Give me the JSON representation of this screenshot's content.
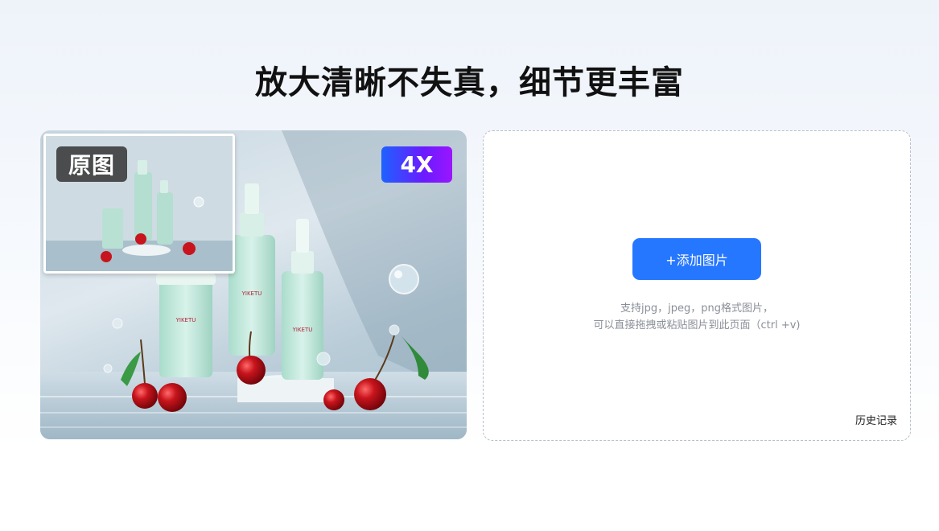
{
  "headline": "放大清晰不失真，细节更丰富",
  "showcase": {
    "original_badge": "原图",
    "zoom_badge": "4X",
    "product_labels": [
      "YIKETU",
      "YIKETU",
      "YIKETU"
    ]
  },
  "upload": {
    "add_button": "+添加图片",
    "hint_line1": "支持jpg，jpeg，png格式图片，",
    "hint_line2": "可以直接拖拽或粘贴图片到此页面（ctrl +v)",
    "history_link": "历史记录"
  },
  "colors": {
    "accent": "#2677ff",
    "zoom_badge_start": "#1e62ff",
    "zoom_badge_end": "#9a16ff",
    "cherry": "#c8141c"
  }
}
